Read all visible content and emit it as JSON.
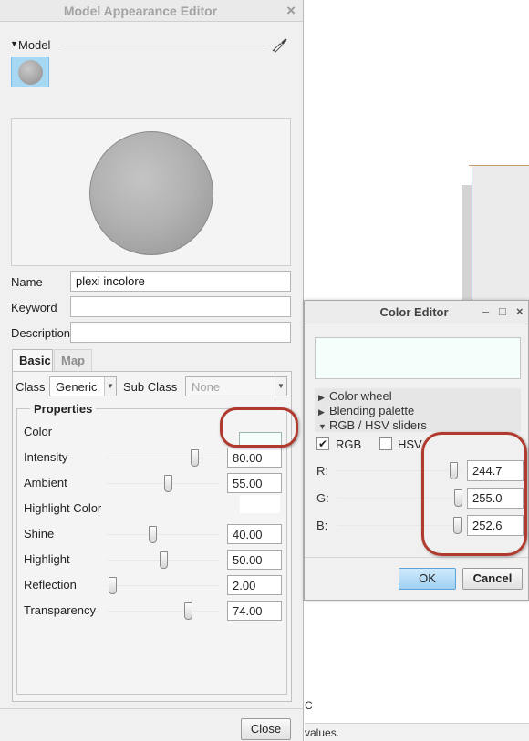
{
  "model_editor": {
    "title": "Model Appearance Editor",
    "close_glyph": "×",
    "model_label": "Model",
    "name_label": "Name",
    "name_value": "plexi incolore",
    "keyword_label": "Keyword",
    "keyword_value": "",
    "description_label": "Description",
    "description_value": "",
    "tabs": {
      "basic": "Basic",
      "map": "Map"
    },
    "class_label": "Class",
    "class_value": "Generic",
    "subclass_label": "Sub Class",
    "subclass_value": "None",
    "properties_title": "Properties",
    "color_label": "Color",
    "color_swatch": "#f4fffc",
    "properties": [
      {
        "label": "Intensity",
        "value": "80.00",
        "level": 80
      },
      {
        "label": "Ambient",
        "value": "55.00",
        "level": 55
      },
      {
        "label": "Highlight Color"
      },
      {
        "label": "Shine",
        "value": "40.00",
        "level": 40
      },
      {
        "label": "Highlight",
        "value": "50.00",
        "level": 50
      },
      {
        "label": "Reflection",
        "value": "2.00",
        "level": 2
      },
      {
        "label": "Transparency",
        "value": "74.00",
        "level": 74
      }
    ],
    "close_button": "Close"
  },
  "color_editor": {
    "title": "Color Editor",
    "min_glyph": "–",
    "max_glyph": "□",
    "close_glyph": "×",
    "preview_color": "#f4fffc",
    "sections": [
      {
        "label": "Color wheel",
        "expanded": false
      },
      {
        "label": "Blending palette",
        "expanded": false
      },
      {
        "label": "RGB / HSV sliders",
        "expanded": true
      }
    ],
    "rgb_label": "RGB",
    "rgb_checked": true,
    "hsv_label": "HSV",
    "hsv_checked": false,
    "channels": [
      {
        "label": "R:",
        "value": "244.7",
        "level": 244.7
      },
      {
        "label": "G:",
        "value": "255.0",
        "level": 255.0
      },
      {
        "label": "B:",
        "value": "252.6",
        "level": 252.6
      }
    ],
    "ok_button": "OK",
    "cancel_button": "Cancel"
  },
  "viewport": {
    "fragment_text": "C",
    "status_text": "values."
  },
  "highlight_color": "#b13a2e"
}
